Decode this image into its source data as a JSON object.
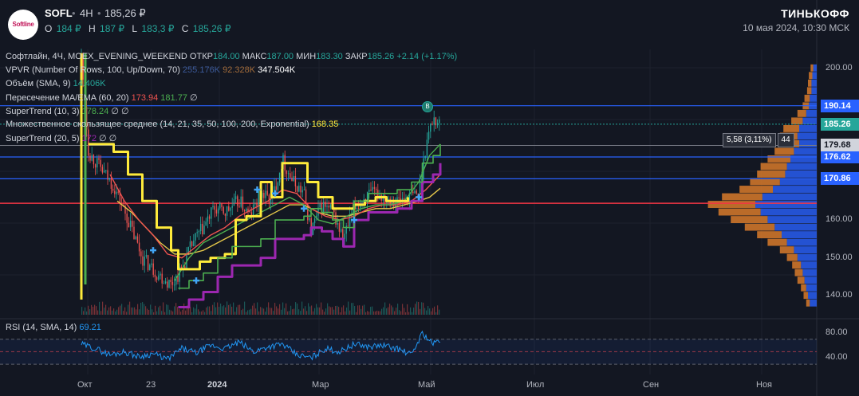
{
  "header": {
    "logo_text": "Softline",
    "symbol": "SOFL",
    "dot": "•",
    "timeframe": "4H",
    "last_price": "185,26 ₽",
    "ohlc": [
      {
        "label": "O",
        "value": "184 ₽"
      },
      {
        "label": "H",
        "value": "187 ₽"
      },
      {
        "label": "L",
        "value": "183,3 ₽"
      },
      {
        "label": "C",
        "value": "185,26 ₽"
      }
    ],
    "brand": "ТИНЬКОФФ",
    "datetime": "10 мая 2024, 10:30 МСК"
  },
  "legend": {
    "main": {
      "title": "Софтлайн, 4Ч, MOEX_EVENING_WEEKEND",
      "open_l": "ОТКР",
      "open_v": "184.00",
      "high_l": "МАКС",
      "high_v": "187.00",
      "low_l": "МИН",
      "low_v": "183.30",
      "close_l": "ЗАКР",
      "close_v": "185.26",
      "change": "+2.14 (+1.17%)"
    },
    "vpvr": {
      "name": "VPVR (Number Of Rows, 100, Up/Down, 70)",
      "v1": "255.176K",
      "v2": "92.328K",
      "v3": "347.504K"
    },
    "volume": {
      "name": "Объём (SMA, 9)",
      "v1": "14.406K"
    },
    "cross": {
      "name": "Пересечение MA/EMA (60, 20)",
      "v1": "173.94",
      "v2": "181.77",
      "v3": "∅"
    },
    "st1": {
      "name": "SuperTrend (10, 3)",
      "v1": "178.24",
      "v2": "∅",
      "v3": "∅"
    },
    "mma": {
      "name": "Множественное скользящее среднее (14, 21, 35, 50, 100, 200, Exponential)",
      "v1": "168.35"
    },
    "st2": {
      "name": "SuperTrend (20, 5)",
      "v1": "172",
      "v2": "∅",
      "v3": "∅"
    },
    "rsi": {
      "name": "RSI (14, SMA, 14)",
      "v1": "69.21"
    }
  },
  "colors": {
    "up": "#26a69a",
    "down": "#ef5350",
    "yellow": "#ffeb3b",
    "purple": "#9c27b0",
    "green": "#4caf50",
    "blue_line": "#2962ff",
    "red_line": "#f23645",
    "rsi": "#2196f3",
    "vpvr_up": "#2962ff",
    "vpvr_down": "#d87a2a"
  },
  "chart_data": {
    "type": "candlestick",
    "x_ticks": [
      "Окт",
      "23",
      "2024",
      "Мар",
      "Май",
      "Июл",
      "Сен",
      "Ноя"
    ],
    "y_ticks": [
      200,
      190,
      180,
      170,
      160,
      150,
      140
    ],
    "y_tick_labels": [
      "200.00",
      "",
      "",
      "",
      "160.00",
      "150.00",
      "140.00"
    ],
    "ylim": [
      135,
      205
    ],
    "horizontal_levels": [
      {
        "value": 190.14,
        "label": "190.14",
        "color": "#2962ff"
      },
      {
        "value": 176.62,
        "label": "176.62",
        "color": "#2962ff"
      },
      {
        "value": 170.86,
        "label": "170.86",
        "color": "#2962ff"
      },
      {
        "value": 164.4,
        "label": "",
        "color": "#f23645"
      }
    ],
    "last_price": {
      "value": 185.26,
      "label": "185.26"
    },
    "measure_level": {
      "value": 179.68,
      "label": "179.68",
      "note": "5,58 (3,11%)",
      "bars": "44"
    },
    "price_path": [
      [
        0,
        203
      ],
      [
        0.02,
        178
      ],
      [
        0.05,
        174
      ],
      [
        0.09,
        169
      ],
      [
        0.13,
        160
      ],
      [
        0.17,
        150
      ],
      [
        0.21,
        146
      ],
      [
        0.25,
        143
      ],
      [
        0.28,
        147
      ],
      [
        0.31,
        154
      ],
      [
        0.34,
        158
      ],
      [
        0.37,
        163
      ],
      [
        0.4,
        162
      ],
      [
        0.44,
        165
      ],
      [
        0.47,
        161
      ],
      [
        0.5,
        167
      ],
      [
        0.53,
        165
      ],
      [
        0.56,
        176
      ],
      [
        0.59,
        170
      ],
      [
        0.62,
        167
      ],
      [
        0.64,
        157
      ],
      [
        0.67,
        164
      ],
      [
        0.7,
        162
      ],
      [
        0.73,
        155
      ],
      [
        0.76,
        163
      ],
      [
        0.79,
        166
      ],
      [
        0.82,
        167
      ],
      [
        0.85,
        166
      ],
      [
        0.88,
        165
      ],
      [
        0.91,
        166
      ],
      [
        0.94,
        167
      ],
      [
        0.96,
        180
      ],
      [
        0.98,
        187
      ],
      [
        1.0,
        185.26
      ]
    ],
    "supertrend_yellow": [
      [
        0.02,
        180
      ],
      [
        0.09,
        178
      ],
      [
        0.13,
        172
      ],
      [
        0.17,
        165
      ],
      [
        0.21,
        158
      ],
      [
        0.25,
        152
      ],
      [
        0.27,
        147
      ],
      [
        0.3,
        147
      ],
      [
        0.33,
        149
      ],
      [
        0.36,
        150
      ],
      [
        0.4,
        151
      ],
      [
        0.43,
        160
      ],
      [
        0.46,
        161
      ],
      [
        0.5,
        170
      ],
      [
        0.53,
        166
      ],
      [
        0.56,
        175
      ],
      [
        0.6,
        175
      ],
      [
        0.63,
        170
      ],
      [
        0.66,
        166
      ],
      [
        0.7,
        163
      ],
      [
        0.73,
        163
      ],
      [
        0.76,
        164
      ],
      [
        0.79,
        165
      ],
      [
        0.82,
        166
      ],
      [
        0.85,
        165
      ],
      [
        0.88,
        165
      ],
      [
        0.91,
        166
      ]
    ],
    "supertrend_purple": [
      [
        0.27,
        137
      ],
      [
        0.3,
        139
      ],
      [
        0.34,
        141
      ],
      [
        0.38,
        145
      ],
      [
        0.42,
        148
      ],
      [
        0.46,
        148
      ],
      [
        0.5,
        150
      ],
      [
        0.54,
        155
      ],
      [
        0.58,
        155
      ],
      [
        0.62,
        156
      ],
      [
        0.64,
        158
      ],
      [
        0.67,
        157
      ],
      [
        0.7,
        155
      ],
      [
        0.73,
        153
      ],
      [
        0.76,
        160
      ],
      [
        0.8,
        162
      ],
      [
        0.84,
        162
      ],
      [
        0.88,
        163
      ],
      [
        0.92,
        165
      ],
      [
        0.95,
        170
      ],
      [
        0.98,
        172
      ],
      [
        1.0,
        175
      ]
    ],
    "ma_red": [
      [
        0.08,
        172
      ],
      [
        0.12,
        165
      ],
      [
        0.16,
        160
      ],
      [
        0.2,
        156
      ],
      [
        0.24,
        151
      ],
      [
        0.28,
        150
      ],
      [
        0.32,
        153
      ],
      [
        0.36,
        156
      ],
      [
        0.4,
        158
      ],
      [
        0.44,
        161
      ],
      [
        0.48,
        163
      ],
      [
        0.52,
        165
      ],
      [
        0.56,
        168
      ],
      [
        0.6,
        167
      ],
      [
        0.64,
        163
      ],
      [
        0.68,
        161
      ],
      [
        0.72,
        160
      ],
      [
        0.76,
        161
      ],
      [
        0.8,
        163
      ],
      [
        0.84,
        164
      ],
      [
        0.88,
        164
      ],
      [
        0.92,
        165
      ],
      [
        0.96,
        168
      ],
      [
        1.0,
        172
      ]
    ],
    "ema_green": [
      [
        0.26,
        144
      ],
      [
        0.3,
        150
      ],
      [
        0.34,
        154
      ],
      [
        0.38,
        156
      ],
      [
        0.42,
        158
      ],
      [
        0.46,
        160
      ],
      [
        0.5,
        162
      ],
      [
        0.54,
        164
      ],
      [
        0.58,
        166
      ],
      [
        0.62,
        164
      ],
      [
        0.66,
        160
      ],
      [
        0.7,
        159
      ],
      [
        0.74,
        161
      ],
      [
        0.78,
        163
      ],
      [
        0.82,
        164
      ],
      [
        0.86,
        164
      ],
      [
        0.9,
        165
      ],
      [
        0.94,
        170
      ],
      [
        0.97,
        177
      ],
      [
        1.0,
        180
      ]
    ],
    "mma_yellow": [
      [
        0.1,
        165
      ],
      [
        0.14,
        162
      ],
      [
        0.18,
        158
      ],
      [
        0.22,
        154
      ],
      [
        0.26,
        151
      ],
      [
        0.3,
        151
      ],
      [
        0.34,
        152
      ],
      [
        0.38,
        154
      ],
      [
        0.42,
        156
      ],
      [
        0.46,
        158
      ],
      [
        0.5,
        160
      ],
      [
        0.54,
        162
      ],
      [
        0.58,
        164
      ],
      [
        0.62,
        164
      ],
      [
        0.66,
        162
      ],
      [
        0.7,
        161
      ],
      [
        0.74,
        161
      ],
      [
        0.78,
        162
      ],
      [
        0.82,
        163
      ],
      [
        0.86,
        163
      ],
      [
        0.9,
        164
      ],
      [
        0.94,
        165
      ],
      [
        0.97,
        166
      ],
      [
        1.0,
        168.35
      ]
    ],
    "rsi": {
      "ylim": [
        20,
        90
      ],
      "y_ticks": [
        80,
        40
      ],
      "y_tick_labels": [
        "80.00",
        "40.00"
      ],
      "bands": [
        70,
        50,
        30
      ],
      "path": [
        [
          0,
          62
        ],
        [
          0.04,
          55
        ],
        [
          0.08,
          45
        ],
        [
          0.12,
          50
        ],
        [
          0.16,
          42
        ],
        [
          0.2,
          47
        ],
        [
          0.24,
          38
        ],
        [
          0.28,
          55
        ],
        [
          0.32,
          48
        ],
        [
          0.36,
          60
        ],
        [
          0.4,
          55
        ],
        [
          0.44,
          65
        ],
        [
          0.48,
          50
        ],
        [
          0.52,
          58
        ],
        [
          0.56,
          62
        ],
        [
          0.6,
          45
        ],
        [
          0.64,
          40
        ],
        [
          0.68,
          55
        ],
        [
          0.72,
          50
        ],
        [
          0.76,
          62
        ],
        [
          0.8,
          58
        ],
        [
          0.84,
          60
        ],
        [
          0.88,
          55
        ],
        [
          0.92,
          45
        ],
        [
          0.95,
          80
        ],
        [
          0.98,
          62
        ],
        [
          1.0,
          69.21
        ]
      ]
    },
    "vpvr_rows": [
      {
        "price": 200,
        "up": 4,
        "down": 3
      },
      {
        "price": 198,
        "up": 5,
        "down": 4
      },
      {
        "price": 196,
        "up": 6,
        "down": 4
      },
      {
        "price": 194,
        "up": 6,
        "down": 5
      },
      {
        "price": 192,
        "up": 8,
        "down": 6
      },
      {
        "price": 190,
        "up": 9,
        "down": 7
      },
      {
        "price": 188,
        "up": 12,
        "down": 10
      },
      {
        "price": 186,
        "up": 16,
        "down": 13
      },
      {
        "price": 184,
        "up": 20,
        "down": 18
      },
      {
        "price": 182,
        "up": 22,
        "down": 20
      },
      {
        "price": 180,
        "up": 20,
        "down": 16
      },
      {
        "price": 178,
        "up": 26,
        "down": 22
      },
      {
        "price": 176,
        "up": 30,
        "down": 26
      },
      {
        "price": 174,
        "up": 34,
        "down": 30
      },
      {
        "price": 172,
        "up": 36,
        "down": 32
      },
      {
        "price": 170,
        "up": 42,
        "down": 34
      },
      {
        "price": 168,
        "up": 50,
        "down": 38
      },
      {
        "price": 166,
        "up": 62,
        "down": 46
      },
      {
        "price": 164,
        "up": 70,
        "down": 54
      },
      {
        "price": 162,
        "up": 64,
        "down": 48
      },
      {
        "price": 160,
        "up": 56,
        "down": 42
      },
      {
        "price": 158,
        "up": 48,
        "down": 34
      },
      {
        "price": 156,
        "up": 40,
        "down": 28
      },
      {
        "price": 154,
        "up": 34,
        "down": 22
      },
      {
        "price": 152,
        "up": 26,
        "down": 16
      },
      {
        "price": 150,
        "up": 22,
        "down": 12
      },
      {
        "price": 148,
        "up": 18,
        "down": 10
      },
      {
        "price": 146,
        "up": 16,
        "down": 9
      },
      {
        "price": 144,
        "up": 14,
        "down": 8
      },
      {
        "price": 142,
        "up": 12,
        "down": 6
      },
      {
        "price": 140,
        "up": 10,
        "down": 5
      },
      {
        "price": 138,
        "up": 8,
        "down": 4
      }
    ],
    "buy_marker": "B"
  }
}
